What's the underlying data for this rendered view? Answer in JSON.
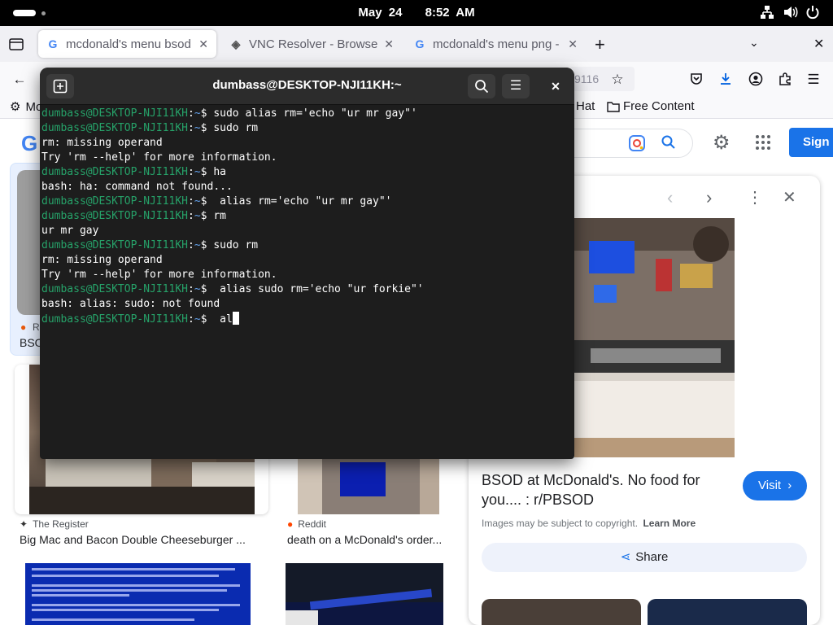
{
  "topbar": {
    "date": "May 24",
    "time": "8:52 AM"
  },
  "browser": {
    "tabs": [
      {
        "label": "mcdonald's menu bsod -",
        "icon": "google-g-icon"
      },
      {
        "label": "VNC Resolver - Browse",
        "icon": "vnc-icon"
      },
      {
        "label": "mcdonald's menu png - G",
        "icon": "google-g-icon"
      }
    ],
    "url_fragment": "9116",
    "bookmarks": [
      {
        "label": "Mo",
        "icon": "gear-icon"
      },
      {
        "label": "Hat",
        "icon": "none"
      },
      {
        "label": "Free Content",
        "icon": "folder-icon"
      }
    ]
  },
  "google": {
    "logo": "G",
    "signin_label": "Sign i",
    "cards": [
      {
        "source": "R",
        "caption": "BSOD"
      },
      {
        "source": "The Register",
        "caption": "Big Mac and Bacon Double Cheeseburger ..."
      },
      {
        "source": "Reddit",
        "caption": "death on a McDonald's order..."
      }
    ]
  },
  "panel": {
    "title": "BSOD at McDonald's. No food for you.... : r/PBSOD",
    "visit_label": "Visit",
    "copyright_note": "Images may be subject to copyright.",
    "learn_more": "Learn More",
    "share_label": "Share"
  },
  "terminal": {
    "title": "dumbass@DESKTOP-NJI11KH:~",
    "prompt_user": "dumbass@DESKTOP-NJI11KH",
    "prompt_path": "~",
    "lines": [
      {
        "type": "prompt",
        "text": "sudo alias rm='echo \"ur mr gay\"'"
      },
      {
        "type": "prompt",
        "text": "sudo rm"
      },
      {
        "type": "output",
        "text": "rm: missing operand"
      },
      {
        "type": "output",
        "text": "Try 'rm --help' for more information."
      },
      {
        "type": "prompt",
        "text": "ha"
      },
      {
        "type": "output",
        "text": "bash: ha: command not found..."
      },
      {
        "type": "prompt",
        "text": " alias rm='echo \"ur mr gay\"'"
      },
      {
        "type": "prompt",
        "text": "rm"
      },
      {
        "type": "output",
        "text": "ur mr gay"
      },
      {
        "type": "prompt",
        "text": "sudo rm"
      },
      {
        "type": "output",
        "text": "rm: missing operand"
      },
      {
        "type": "output",
        "text": "Try 'rm --help' for more information."
      },
      {
        "type": "prompt",
        "text": " alias sudo rm='echo \"ur forkie\"'"
      },
      {
        "type": "output",
        "text": "bash: alias: sudo: not found"
      },
      {
        "type": "prompt",
        "text": " al",
        "cursor": true
      }
    ]
  },
  "colors": {
    "prompt_user": "#26a269",
    "prompt_path": "#62a0ea",
    "google_blue": "#1a73e8"
  }
}
